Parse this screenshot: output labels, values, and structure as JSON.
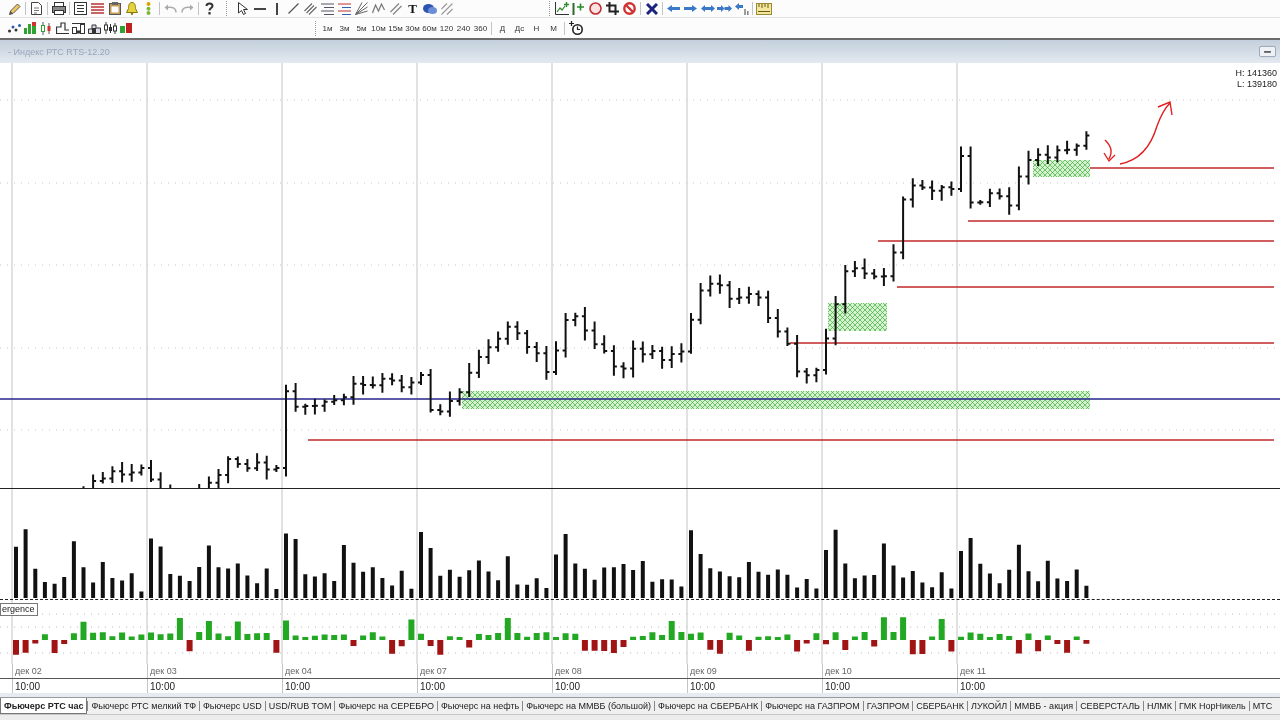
{
  "toolbar": {
    "text_tool": "T",
    "timeframes": [
      "1м",
      "3м",
      "5м",
      "10м",
      "15м",
      "30м",
      "60м",
      "120",
      "240",
      "360"
    ],
    "periods": [
      "Д",
      "Дс",
      "Н",
      "М"
    ]
  },
  "chart_window": {
    "title": "- Индекс РТС RTS-12.20",
    "high_label": "H: 141360",
    "low_label": "L: 139180",
    "indicator_label": "ergence",
    "date_axis": [
      {
        "date": "дек 02",
        "time": "10:00"
      },
      {
        "date": "дек 03",
        "time": "10:00"
      },
      {
        "date": "дек 04",
        "time": "10:00"
      },
      {
        "date": "дек 07",
        "time": "10:00"
      },
      {
        "date": "дек 08",
        "time": "10:00"
      },
      {
        "date": "дек 09",
        "time": "10:00"
      },
      {
        "date": "дек 10",
        "time": "10:00"
      },
      {
        "date": "дек 11",
        "time": "10:00"
      }
    ]
  },
  "tabs": [
    {
      "label": "Фьючерс РТС час",
      "selected": true
    },
    {
      "label": "Фьючерс РТС мелкий ТФ",
      "selected": false
    },
    {
      "label": "Фьючерс USD",
      "selected": false
    },
    {
      "label": "USD/RUB TOM",
      "selected": false
    },
    {
      "label": "Фьючерс на СЕРЕБРО",
      "selected": false
    },
    {
      "label": "Фьючерс на нефть",
      "selected": false
    },
    {
      "label": "Фьючерс на ММВБ (большой)",
      "selected": false
    },
    {
      "label": "Фьючерс на СБЕРБАНК",
      "selected": false
    },
    {
      "label": "Фьючерс на ГАЗПРОМ",
      "selected": false
    },
    {
      "label": "ГАЗПРОМ",
      "selected": false
    },
    {
      "label": "СБЕРБАНК",
      "selected": false
    },
    {
      "label": "ЛУКОЙЛ",
      "selected": false
    },
    {
      "label": "ММВБ - акция",
      "selected": false
    },
    {
      "label": "СЕВЕРСТАЛЬ",
      "selected": false
    },
    {
      "label": "НЛМК",
      "selected": false
    },
    {
      "label": "ГМК НорНикель",
      "selected": false
    },
    {
      "label": "МТС",
      "selected": false
    }
  ]
}
